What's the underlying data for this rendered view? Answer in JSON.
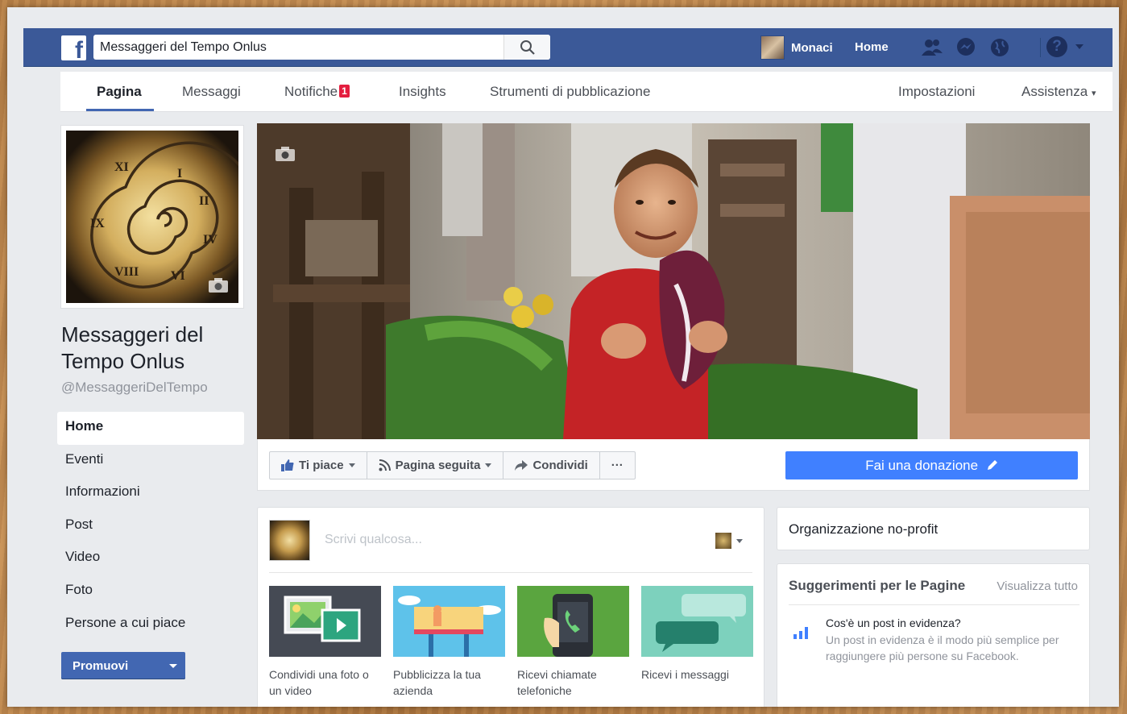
{
  "topbar": {
    "logo_letter": "f",
    "search_value": "Messaggeri del Tempo Onlus",
    "user_name": "Monaci",
    "home_label": "Home"
  },
  "page_nav": {
    "tabs": [
      {
        "label": "Pagina"
      },
      {
        "label": "Messaggi"
      },
      {
        "label": "Notifiche"
      },
      {
        "label": "Insights"
      },
      {
        "label": "Strumenti di pubblicazione"
      }
    ],
    "notif_count": "1",
    "settings": "Impostazioni",
    "help": "Assistenza"
  },
  "page": {
    "name": "Messaggeri del Tempo Onlus",
    "handle": "@MessaggeriDelTempo"
  },
  "left_nav": [
    {
      "label": "Home"
    },
    {
      "label": "Eventi"
    },
    {
      "label": "Informazioni"
    },
    {
      "label": "Post"
    },
    {
      "label": "Video"
    },
    {
      "label": "Foto"
    },
    {
      "label": "Persone a cui piace"
    }
  ],
  "promote_label": "Promuovi",
  "actions": {
    "like": "Ti piace",
    "following": "Pagina seguita",
    "share": "Condividi",
    "more": "···",
    "donate": "Fai una donazione"
  },
  "composer": {
    "placeholder": "Scrivi qualcosa...",
    "tiles": [
      {
        "label": "Condividi una foto o un video"
      },
      {
        "label": "Pubblicizza la tua azienda"
      },
      {
        "label": "Ricevi chiamate telefoniche"
      },
      {
        "label": "Ricevi i messaggi"
      }
    ]
  },
  "category": "Organizzazione no-profit",
  "suggestions": {
    "title": "Suggerimenti per le Pagine",
    "see_all": "Visualizza tutto",
    "question": "Cos'è un post in evidenza?",
    "description": "Un post in evidenza è il modo più semplice per raggiungere più persone su Facebook."
  },
  "colors": {
    "fb_blue": "#3b5998",
    "accent": "#4267b2",
    "donate": "#4080ff",
    "notification": "#e41e3f"
  }
}
